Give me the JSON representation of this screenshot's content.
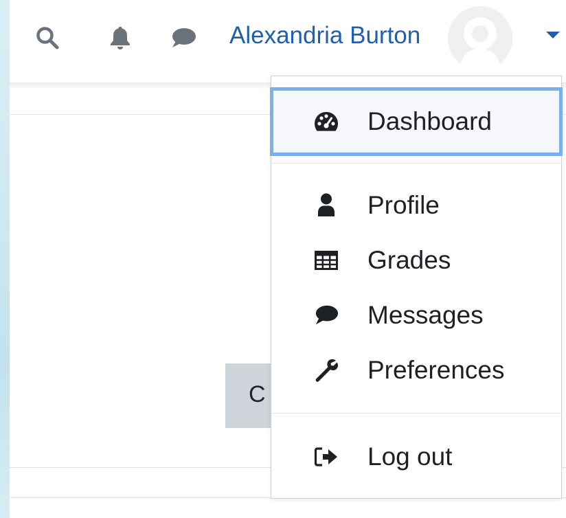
{
  "navbar": {
    "search_icon": "search-icon",
    "notifications_icon": "bell-icon",
    "messages_icon": "chat-bubble-icon",
    "user_name": "Alexandria Burton",
    "avatar_icon": "default-avatar-icon",
    "menu_toggle_icon": "caret-down-icon"
  },
  "page": {
    "partial_button_text": "C"
  },
  "user_menu": {
    "items": [
      {
        "label": "Dashboard",
        "icon": "dashboard-gauge-icon",
        "focused": true
      },
      {
        "label": "Profile",
        "icon": "user-icon"
      },
      {
        "label": "Grades",
        "icon": "table-grid-icon"
      },
      {
        "label": "Messages",
        "icon": "chat-bubble-icon"
      },
      {
        "label": "Preferences",
        "icon": "wrench-icon"
      },
      {
        "label": "Log out",
        "icon": "sign-out-icon"
      }
    ]
  },
  "colors": {
    "link_blue": "#1f5fad",
    "focus_ring": "#7ab0ee",
    "icon_grey": "#6a737b",
    "text_dark": "#1d2125"
  }
}
